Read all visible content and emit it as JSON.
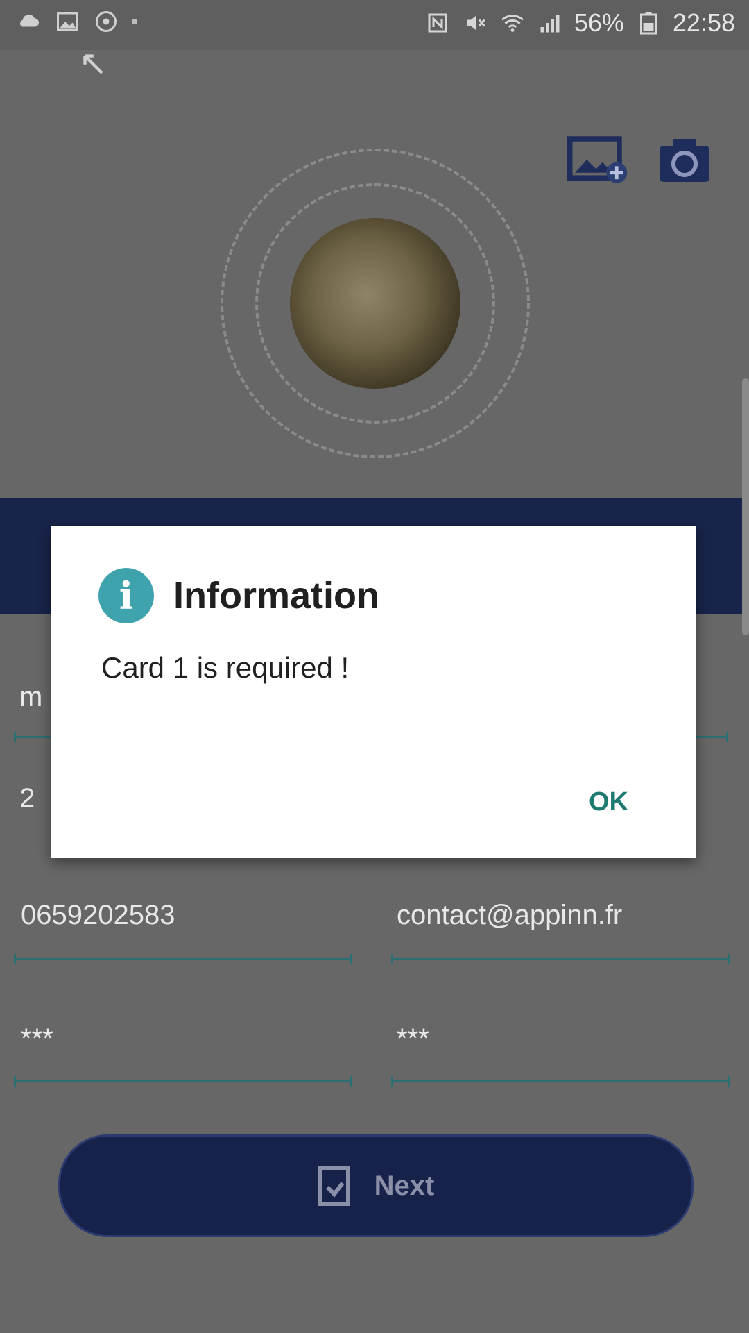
{
  "status_bar": {
    "battery": "56%",
    "time": "22:58"
  },
  "dialog": {
    "title": "Information",
    "message": "Card 1 is required !",
    "ok_label": "OK"
  },
  "form": {
    "partial_field_1": "m",
    "partial_field_2": "2",
    "phone": "0659202583",
    "email": "contact@appinn.fr",
    "password": "***",
    "confirm_password": "***"
  },
  "next_button": {
    "label": "Next"
  },
  "colors": {
    "band": "#18244a",
    "accent": "#3fa3ad",
    "ok_text": "#1f7b72",
    "underline": "#2c6f73"
  }
}
